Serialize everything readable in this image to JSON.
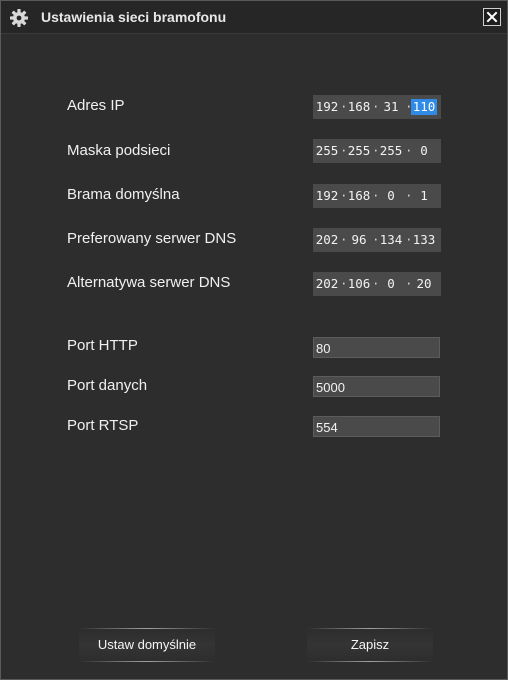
{
  "window": {
    "title": "Ustawienia sieci bramofonu",
    "settings_icon": "gear-icon",
    "close_icon": "close-icon"
  },
  "network": {
    "ip": {
      "label": "Adres IP",
      "octets": [
        "192",
        "168",
        "31",
        "110"
      ]
    },
    "mask": {
      "label": "Maska podsieci",
      "octets": [
        "255",
        "255",
        "255",
        "0"
      ]
    },
    "gateway": {
      "label": "Brama domyślna",
      "octets": [
        "192",
        "168",
        "0",
        "1"
      ]
    },
    "dns1": {
      "label": "Preferowany serwer DNS",
      "octets": [
        "202",
        "96",
        "134",
        "133"
      ]
    },
    "dns2": {
      "label": "Alternatywa serwer DNS",
      "octets": [
        "202",
        "106",
        "0",
        "20"
      ]
    }
  },
  "ports": {
    "http": {
      "label": "Port HTTP",
      "value": "80"
    },
    "data": {
      "label": "Port danych",
      "value": "5000"
    },
    "rtsp": {
      "label": "Port RTSP",
      "value": "554"
    }
  },
  "buttons": {
    "defaults": "Ustaw domyślnie",
    "save": "Zapisz"
  },
  "colors": {
    "background": "#2d2d2d",
    "field": "#4a4a4a",
    "selection": "#2f8be6"
  }
}
